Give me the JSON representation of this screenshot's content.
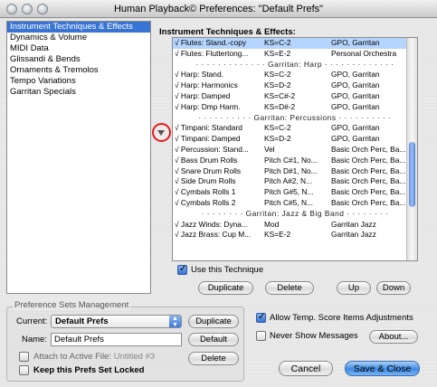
{
  "window": {
    "title": "Human Playback© Preferences: \"Default Prefs\""
  },
  "categories": [
    {
      "label": "Instrument Techniques & Effects",
      "selected": true
    },
    {
      "label": "Dynamics & Volume",
      "selected": false
    },
    {
      "label": "MIDI Data",
      "selected": false
    },
    {
      "label": "Glissandi & Bends",
      "selected": false
    },
    {
      "label": "Ornaments & Tremolos",
      "selected": false
    },
    {
      "label": "Tempo Variations",
      "selected": false
    },
    {
      "label": "Garritan Specials",
      "selected": false
    }
  ],
  "techniques": {
    "heading": "Instrument Techniques & Effects:",
    "rows": [
      {
        "type": "item",
        "name": "√ Flutes: Stand.-copy",
        "ks": "KS=C-2",
        "lib": "GPO, Garritan",
        "selected": true
      },
      {
        "type": "item",
        "name": "√ Flutes: Fluttertong...",
        "ks": "KS=E-2",
        "lib": "Personal Orchestra"
      },
      {
        "type": "sep",
        "text": "· · · · · · · · · · · · · Garritan: Harp · · · · · · · · · · · · ·"
      },
      {
        "type": "item",
        "name": "√ Harp: Stand.",
        "ks": "KS=C-2",
        "lib": "GPO, Garritan"
      },
      {
        "type": "item",
        "name": "√ Harp: Harmonics",
        "ks": "KS=D-2",
        "lib": "GPO, Garritan"
      },
      {
        "type": "item",
        "name": "√ Harp: Damped",
        "ks": "KS=C#-2",
        "lib": "GPO, Garritan"
      },
      {
        "type": "item",
        "name": "√ Harp: Dmp Harm.",
        "ks": "KS=D#-2",
        "lib": "GPO, Garritan"
      },
      {
        "type": "sep",
        "text": "· · · · · · · · · · Garritan: Percussions · · · · · · · · · ·"
      },
      {
        "type": "item",
        "name": "√ Timpani: Standard",
        "ks": "KS=C-2",
        "lib": "GPO, Garritan"
      },
      {
        "type": "item",
        "name": "√ Timpani: Damped",
        "ks": "KS=D-2",
        "lib": "GPO, Garritan"
      },
      {
        "type": "item",
        "name": "√ Percussion: Stand...",
        "ks": "Vel",
        "lib": "Basic Orch Perc, Ba..."
      },
      {
        "type": "item",
        "name": "√ Bass Drum Rolls",
        "ks": "Pitch C#1, No...",
        "lib": "Basic Orch Perc, Ba..."
      },
      {
        "type": "item",
        "name": "√ Snare Drum Rolls",
        "ks": "Pitch D#1, No...",
        "lib": "Basic Orch Perc, Ba..."
      },
      {
        "type": "item",
        "name": "√ Side Drum Rolls",
        "ks": "Pitch A#2, N...",
        "lib": "Basic Orch Perc, Ba..."
      },
      {
        "type": "item",
        "name": "√ Cymbals Rolls 1",
        "ks": "Pitch G#5, N...",
        "lib": "Basic Orch Perc, Ba..."
      },
      {
        "type": "item",
        "name": "√ Cymbals Rolls 2",
        "ks": "Pitch C#5, N...",
        "lib": "Basic Orch Perc, Ba..."
      },
      {
        "type": "sep",
        "text": "· · · · · · · · Garritan: Jazz & Big Band · · · · · · · ·"
      },
      {
        "type": "item",
        "name": "√ Jazz Winds: Dyna...",
        "ks": "Mod",
        "lib": "Garritan Jazz"
      },
      {
        "type": "item",
        "name": "√ Jazz Brass: Cup M...",
        "ks": "KS=E-2",
        "lib": "Garritan Jazz"
      }
    ]
  },
  "use_technique": {
    "label": "Use this Technique",
    "checked": true
  },
  "buttons": {
    "duplicate": "Duplicate",
    "delete": "Delete",
    "up": "Up",
    "down": "Down",
    "sets_duplicate": "Duplicate",
    "sets_default": "Default",
    "sets_delete": "Delete",
    "about": "About...",
    "cancel": "Cancel",
    "save_close": "Save & Close"
  },
  "sets": {
    "title": "Preference Sets Management",
    "current_label": "Current:",
    "current_value": "Default Prefs",
    "name_label": "Name:",
    "name_value": "Default Prefs",
    "attach_label": "Attach to Active File:",
    "attach_file": "Untitled #3",
    "attach_checked": false,
    "keep_label": "Keep this Prefs Set Locked",
    "keep_checked": false
  },
  "options": {
    "allow_temp": "Allow Temp. Score Items Adjustments",
    "allow_temp_checked": true,
    "never_show": "Never Show Messages",
    "never_show_checked": false
  },
  "icons": {
    "marker": "triangle-down-icon"
  },
  "colors": {
    "selection": "#3874d4",
    "row_highlight": "#b5d5ff",
    "marker": "#e31b1b"
  }
}
